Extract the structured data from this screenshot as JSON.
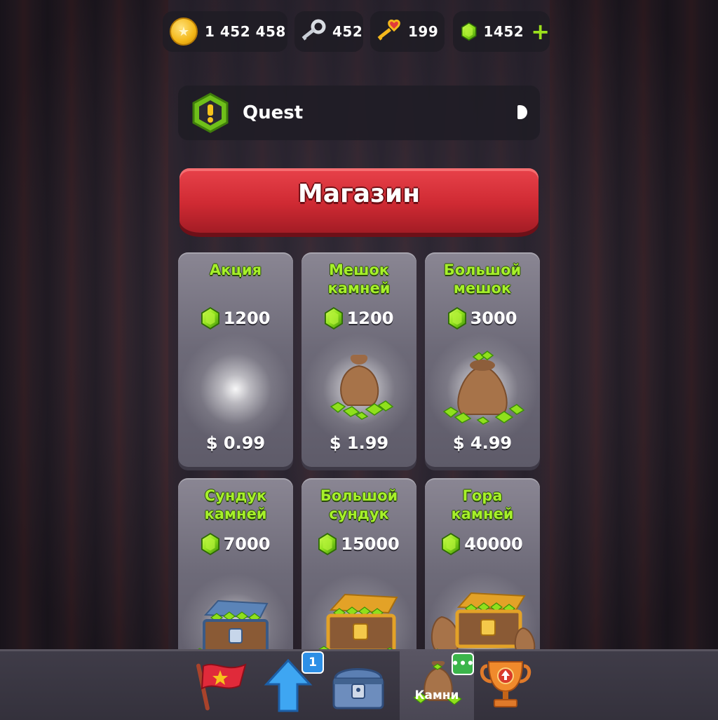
{
  "currencies": {
    "coins": "1 452 458",
    "silver_keys": "452",
    "gold_keys": "199",
    "gems": "1452"
  },
  "quest": {
    "title": "Quest"
  },
  "shop": {
    "title": "Магазин",
    "items": [
      {
        "name": "Акция",
        "amount": "1200",
        "price": "$ 0.99"
      },
      {
        "name": "Мешок\nкамней",
        "amount": "1200",
        "price": "$ 1.99"
      },
      {
        "name": "Большой\nмешок",
        "amount": "3000",
        "price": "$ 4.99"
      },
      {
        "name": "Сундук\nкамней",
        "amount": "7000"
      },
      {
        "name": "Большой\nсундук",
        "amount": "15000"
      },
      {
        "name": "Гора\nкамней",
        "amount": "40000"
      }
    ]
  },
  "bottom_nav": {
    "upgrade_badge": "1",
    "gems_badge": "•••",
    "gems_label": "Камни"
  },
  "colors": {
    "gem": "#8fe01c",
    "banner": "#d92f38",
    "title_green": "#a6f02a"
  }
}
